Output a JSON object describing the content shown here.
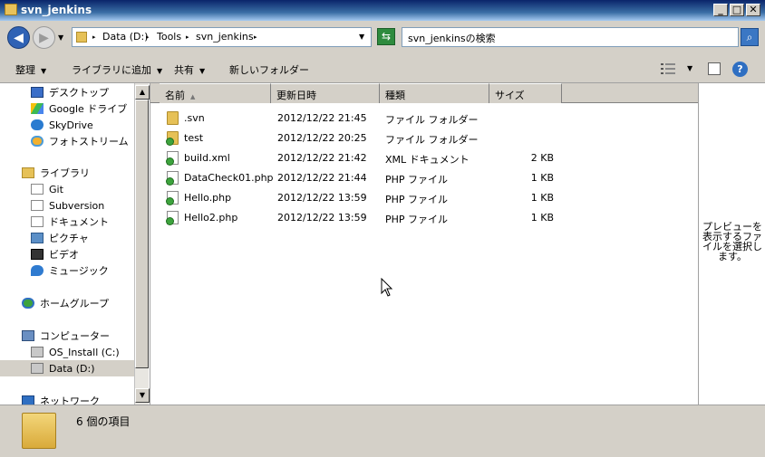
{
  "window": {
    "title": "svn_jenkins"
  },
  "titlebar": {
    "minimize": "_",
    "maximize": "□",
    "close": "✕"
  },
  "address": {
    "breadcrumb": [
      "Data (D:)",
      "Tools",
      "svn_jenkins"
    ],
    "search_placeholder": "svn_jenkinsの検索"
  },
  "commands": [
    {
      "label": "整理",
      "dropdown": true
    },
    {
      "label": "ライブラリに追加",
      "dropdown": true
    },
    {
      "label": "共有",
      "dropdown": true
    },
    {
      "label": "新しいフォルダー",
      "dropdown": false
    }
  ],
  "navigation": {
    "favorites": [
      {
        "label": "デスクトップ",
        "icon": "desktop-icon"
      },
      {
        "label": "Google ドライブ",
        "icon": "google-drive-icon"
      },
      {
        "label": "SkyDrive",
        "icon": "skydrive-icon"
      },
      {
        "label": "フォトストリーム",
        "icon": "photostream-icon"
      }
    ],
    "libraries_label": "ライブラリ",
    "libraries": [
      {
        "label": "Git",
        "icon": "git-icon"
      },
      {
        "label": "Subversion",
        "icon": "subversion-icon"
      },
      {
        "label": "ドキュメント",
        "icon": "documents-icon"
      },
      {
        "label": "ピクチャ",
        "icon": "pictures-icon"
      },
      {
        "label": "ビデオ",
        "icon": "video-icon"
      },
      {
        "label": "ミュージック",
        "icon": "music-icon"
      }
    ],
    "homegroup_label": "ホームグループ",
    "computer_label": "コンピューター",
    "drives": [
      {
        "label": "OS_Install (C:)",
        "selected": false
      },
      {
        "label": "Data (D:)",
        "selected": true
      }
    ],
    "network_label": "ネットワーク"
  },
  "columns": {
    "name": "名前",
    "modified": "更新日時",
    "type": "種類",
    "size": "サイズ"
  },
  "files": [
    {
      "name": ".svn",
      "modified": "2012/12/22 21:45",
      "type": "ファイル フォルダー",
      "size": "",
      "kind": "folder"
    },
    {
      "name": "test",
      "modified": "2012/12/22 20:25",
      "type": "ファイル フォルダー",
      "size": "",
      "kind": "folder-svn"
    },
    {
      "name": "build.xml",
      "modified": "2012/12/22 21:42",
      "type": "XML ドキュメント",
      "size": "2 KB",
      "kind": "doc"
    },
    {
      "name": "DataCheck01.php",
      "modified": "2012/12/22 21:44",
      "type": "PHP ファイル",
      "size": "1 KB",
      "kind": "doc"
    },
    {
      "name": "Hello.php",
      "modified": "2012/12/22 13:59",
      "type": "PHP ファイル",
      "size": "1 KB",
      "kind": "doc"
    },
    {
      "name": "Hello2.php",
      "modified": "2012/12/22 13:59",
      "type": "PHP ファイル",
      "size": "1 KB",
      "kind": "doc"
    }
  ],
  "preview": {
    "lines": [
      "プレビューを",
      "表示するファ",
      "イルを選択し",
      "ます。"
    ]
  },
  "details": {
    "item_count": "6 個の項目"
  },
  "colors": {
    "title_bar": "#0a246a",
    "chrome": "#d4d0c8",
    "folder": "#e6c157",
    "svn_badge": "#3da33d"
  }
}
